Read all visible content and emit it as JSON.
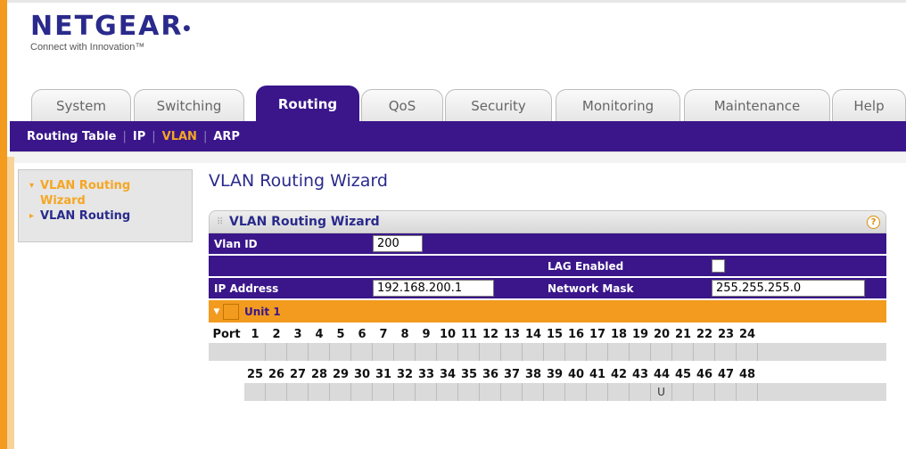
{
  "brand": {
    "name": "NETGEAR",
    "tagline": "Connect with Innovation™"
  },
  "tabs": [
    {
      "label": "System",
      "active": false
    },
    {
      "label": "Switching",
      "active": false
    },
    {
      "label": "Routing",
      "active": true
    },
    {
      "label": "QoS",
      "active": false
    },
    {
      "label": "Security",
      "active": false
    },
    {
      "label": "Monitoring",
      "active": false
    },
    {
      "label": "Maintenance",
      "active": false
    },
    {
      "label": "Help",
      "active": false
    }
  ],
  "subnav": [
    {
      "label": "Routing Table",
      "active": false
    },
    {
      "label": "IP",
      "active": false
    },
    {
      "label": "VLAN",
      "active": true
    },
    {
      "label": "ARP",
      "active": false
    }
  ],
  "sidemenu": [
    {
      "label": "VLAN Routing Wizard",
      "active": true
    },
    {
      "label": "VLAN Routing",
      "active": false
    }
  ],
  "page_title": "VLAN Routing Wizard",
  "panel": {
    "title": "VLAN Routing Wizard",
    "vlan_id_label": "Vlan ID",
    "vlan_id_value": "200",
    "lag_label": "LAG Enabled",
    "lag_checked": false,
    "ip_label": "IP Address",
    "ip_value": "192.168.200.1",
    "mask_label": "Network Mask",
    "mask_value": "255.255.255.0",
    "unit_label": "Unit 1",
    "port_label": "Port",
    "ports_row1": [
      "1",
      "2",
      "3",
      "4",
      "5",
      "6",
      "7",
      "8",
      "9",
      "10",
      "11",
      "12",
      "13",
      "14",
      "15",
      "16",
      "17",
      "18",
      "19",
      "20",
      "21",
      "22",
      "23",
      "24"
    ],
    "ports_row2": [
      "25",
      "26",
      "27",
      "28",
      "29",
      "30",
      "31",
      "32",
      "33",
      "34",
      "35",
      "36",
      "37",
      "38",
      "39",
      "40",
      "41",
      "42",
      "43",
      "44",
      "45",
      "46",
      "47",
      "48"
    ],
    "port_status": {
      "44": "U"
    }
  },
  "colors": {
    "accent_purple": "#3a168a",
    "accent_orange": "#f29b1f",
    "active_text": "#f5a623"
  }
}
